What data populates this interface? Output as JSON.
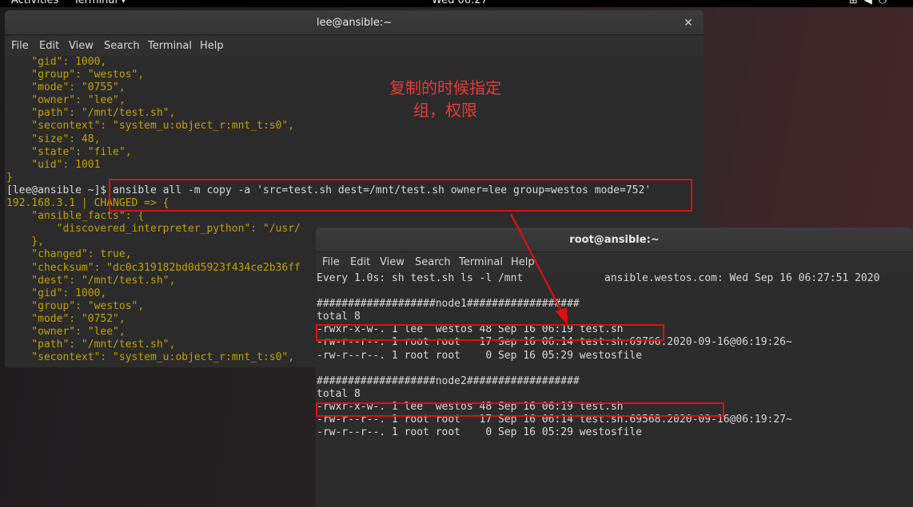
{
  "topbar": {
    "activities": "Activities",
    "app": "Terminal ▾",
    "clock": "Wed 06:27",
    "tray_icons": [
      "network-icon",
      "volume-icon",
      "power-icon"
    ]
  },
  "window1": {
    "title": "lee@ansible:~",
    "menu": [
      "File",
      "Edit",
      "View",
      "Search",
      "Terminal",
      "Help"
    ],
    "lines": [
      {
        "text": "    \"gid\": 1000,",
        "color": "yellow"
      },
      {
        "text": "    \"group\": \"westos\",",
        "color": "yellow"
      },
      {
        "text": "    \"mode\": \"0755\",",
        "color": "yellow"
      },
      {
        "text": "    \"owner\": \"lee\",",
        "color": "yellow"
      },
      {
        "text": "    \"path\": \"/mnt/test.sh\",",
        "color": "yellow"
      },
      {
        "text": "    \"secontext\": \"system_u:object_r:mnt_t:s0\",",
        "color": "yellow"
      },
      {
        "text": "    \"size\": 48,",
        "color": "yellow"
      },
      {
        "text": "    \"state\": \"file\",",
        "color": "yellow"
      },
      {
        "text": "    \"uid\": 1001",
        "color": "yellow"
      },
      {
        "text": "}",
        "color": "yellow"
      },
      {
        "text": "[lee@ansible ~]$ ansible all -m copy -a 'src=test.sh dest=/mnt/test.sh owner=lee group=westos mode=752'",
        "color": "white"
      },
      {
        "text": "192.168.3.1 | CHANGED => {",
        "color": "yellow"
      },
      {
        "text": "    \"ansible_facts\": {",
        "color": "yellow"
      },
      {
        "text": "        \"discovered_interpreter_python\": \"/usr/",
        "color": "yellow"
      },
      {
        "text": "    },",
        "color": "yellow"
      },
      {
        "text": "    \"changed\": true,",
        "color": "yellow"
      },
      {
        "text": "    \"checksum\": \"dc0c319182bd0d5923f434ce2b36ff",
        "color": "yellow"
      },
      {
        "text": "    \"dest\": \"/mnt/test.sh\",",
        "color": "yellow"
      },
      {
        "text": "    \"gid\": 1000,",
        "color": "yellow"
      },
      {
        "text": "    \"group\": \"westos\",",
        "color": "yellow"
      },
      {
        "text": "    \"mode\": \"0752\",",
        "color": "yellow"
      },
      {
        "text": "    \"owner\": \"lee\",",
        "color": "yellow"
      },
      {
        "text": "    \"path\": \"/mnt/test.sh\",",
        "color": "yellow"
      },
      {
        "text": "    \"secontext\": \"system_u:object_r:mnt_t:s0\",",
        "color": "yellow"
      }
    ]
  },
  "window2": {
    "title": "root@ansible:~",
    "menu": [
      "File",
      "Edit",
      "View",
      "Search",
      "Terminal",
      "Help"
    ],
    "lines": [
      {
        "text": "Every 1.0s: sh test.sh ls -l /mnt             ansible.westos.com: Wed Sep 16 06:27:51 2020"
      },
      {
        "text": ""
      },
      {
        "text": "###################node1##################"
      },
      {
        "text": "total 8"
      },
      {
        "text": "-rwxr-x-w-. 1 lee  westos 48 Sep 16 06:19 test.sh"
      },
      {
        "text": "-rw-r--r--. 1 root root   17 Sep 16 06:14 test.sh.69766.2020-09-16@06:19:26~"
      },
      {
        "text": "-rw-r--r--. 1 root root    0 Sep 16 05:29 westosfile"
      },
      {
        "text": ""
      },
      {
        "text": "###################node2##################"
      },
      {
        "text": "total 8"
      },
      {
        "text": "-rwxr-x-w-. 1 lee  westos 48 Sep 16 06:19 test.sh"
      },
      {
        "text": "-rw-r--r--. 1 root root   17 Sep 16 06:14 test.sh.69568.2020-09-16@06:19:27~"
      },
      {
        "text": "-rw-r--r--. 1 root root    0 Sep 16 05:29 westosfile"
      }
    ]
  },
  "annotation": {
    "line1": "复制的时候指定",
    "line2": "组，权限",
    "color": "#e83a3a"
  },
  "colors": {
    "terminal_yellow": "#c4a000",
    "highlight_red": "#e01010"
  }
}
